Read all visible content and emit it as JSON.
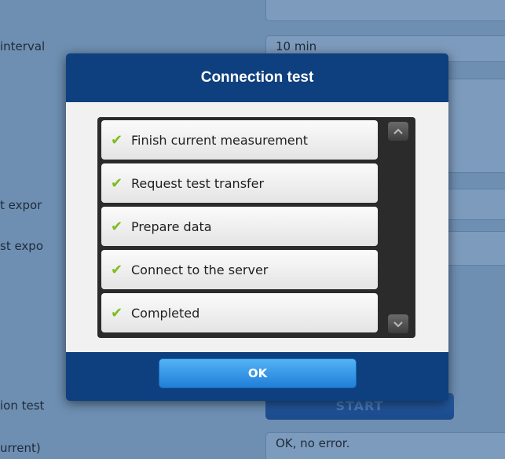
{
  "background": {
    "labels": [
      {
        "text": "interval"
      },
      {
        "text": "t expor"
      },
      {
        "text": "st expo"
      },
      {
        "text": "ion test"
      },
      {
        "text": "urrent)"
      }
    ],
    "fields": {
      "interval_value": "10 min",
      "status_value": "OK, no error."
    },
    "start_button": "START"
  },
  "dialog": {
    "title": "Connection test",
    "steps": [
      {
        "label": "Finish current measurement",
        "icon": "check-icon"
      },
      {
        "label": "Request test transfer",
        "icon": "check-icon"
      },
      {
        "label": "Prepare data",
        "icon": "check-icon"
      },
      {
        "label": "Connect to the server",
        "icon": "check-icon"
      },
      {
        "label": "Completed",
        "icon": "check-icon"
      }
    ],
    "ok_label": "OK"
  },
  "colors": {
    "dialog_header": "#0e3f7e",
    "check": "#7cbd1e",
    "ok_button": "#2f8fe3",
    "background_overlay": "#6e8fb2"
  }
}
